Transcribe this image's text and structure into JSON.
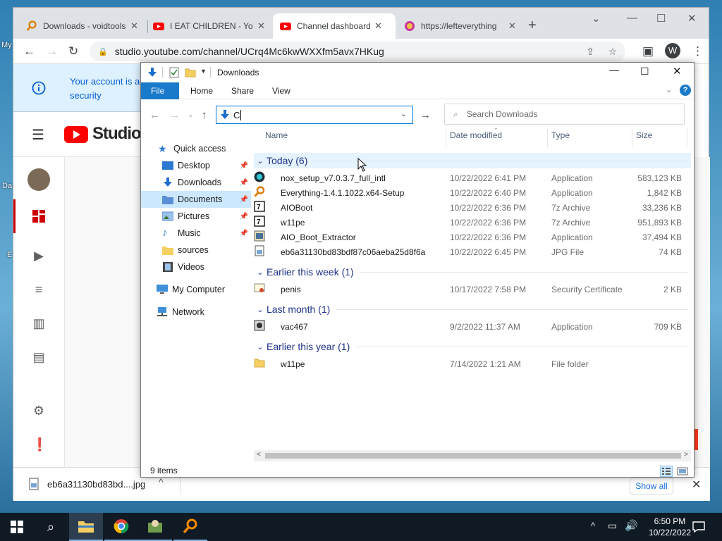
{
  "desktop": {
    "label_my": "My",
    "label_da": "Da",
    "label_e": "E"
  },
  "browser": {
    "tabs": [
      {
        "title": "Downloads - voidtools"
      },
      {
        "title": "I EAT CHILDREN - YouTube"
      },
      {
        "title": "Channel dashboard - YouTube Studio"
      },
      {
        "title": "https://lefteverything"
      }
    ],
    "url": "studio.youtube.com/channel/UCrq4Mc6kwWXXfm5avx7HKug",
    "profile_initial": "W"
  },
  "youtube": {
    "banner_text": "Your account is a security",
    "logo_text": "Studio"
  },
  "download_shelf": {
    "filename": "eb6a31130bd83bd....jpg",
    "show_all": "Show all"
  },
  "explorer": {
    "title": "Downloads",
    "ribbon_tabs": [
      "File",
      "Home",
      "Share",
      "View"
    ],
    "address_value": "C",
    "search_placeholder": "Search Downloads",
    "nav": {
      "quick_access": "Quick access",
      "desktop": "Desktop",
      "downloads": "Downloads",
      "documents": "Documents",
      "pictures": "Pictures",
      "music": "Music",
      "sources": "sources",
      "videos": "Videos",
      "my_computer": "My Computer",
      "network": "Network"
    },
    "columns": {
      "name": "Name",
      "date": "Date modified",
      "type": "Type",
      "size": "Size"
    },
    "groups": [
      {
        "label": "Today (6)"
      },
      {
        "label": "Earlier this week (1)"
      },
      {
        "label": "Last month (1)"
      },
      {
        "label": "Earlier this year (1)"
      }
    ],
    "files": [
      {
        "name": "nox_setup_v7.0.3.7_full_intl",
        "date": "10/22/2022 6:41 PM",
        "type": "Application",
        "size": "583,123 KB",
        "icon": "nox-icon"
      },
      {
        "name": "Everything-1.4.1.1022.x64-Setup",
        "date": "10/22/2022 6:40 PM",
        "type": "Application",
        "size": "1,842 KB",
        "icon": "everything-icon"
      },
      {
        "name": "AIOBoot",
        "date": "10/22/2022 6:36 PM",
        "type": "7z Archive",
        "size": "33,236 KB",
        "icon": "7z-icon"
      },
      {
        "name": "w11pe",
        "date": "10/22/2022 6:36 PM",
        "type": "7z Archive",
        "size": "951,893 KB",
        "icon": "7z-icon"
      },
      {
        "name": "AIO_Boot_Extractor",
        "date": "10/22/2022 6:36 PM",
        "type": "Application",
        "size": "37,494 KB",
        "icon": "app-icon"
      },
      {
        "name": "eb6a31130bd83bdf87c06aeba25d8f6a",
        "date": "10/22/2022 6:45 PM",
        "type": "JPG File",
        "size": "74 KB",
        "icon": "image-icon"
      },
      {
        "name": "penis",
        "date": "10/17/2022 7:58 PM",
        "type": "Security Certificate",
        "size": "2 KB",
        "icon": "certificate-icon"
      },
      {
        "name": "vac467",
        "date": "9/2/2022 11:37 AM",
        "type": "Application",
        "size": "709 KB",
        "icon": "app-icon"
      },
      {
        "name": "w11pe",
        "date": "7/14/2022 1:21 AM",
        "type": "File folder",
        "size": "",
        "icon": "folder-icon"
      }
    ],
    "status": "9 items"
  },
  "taskbar": {
    "time": "6:50 PM",
    "date": "10/22/2022"
  }
}
